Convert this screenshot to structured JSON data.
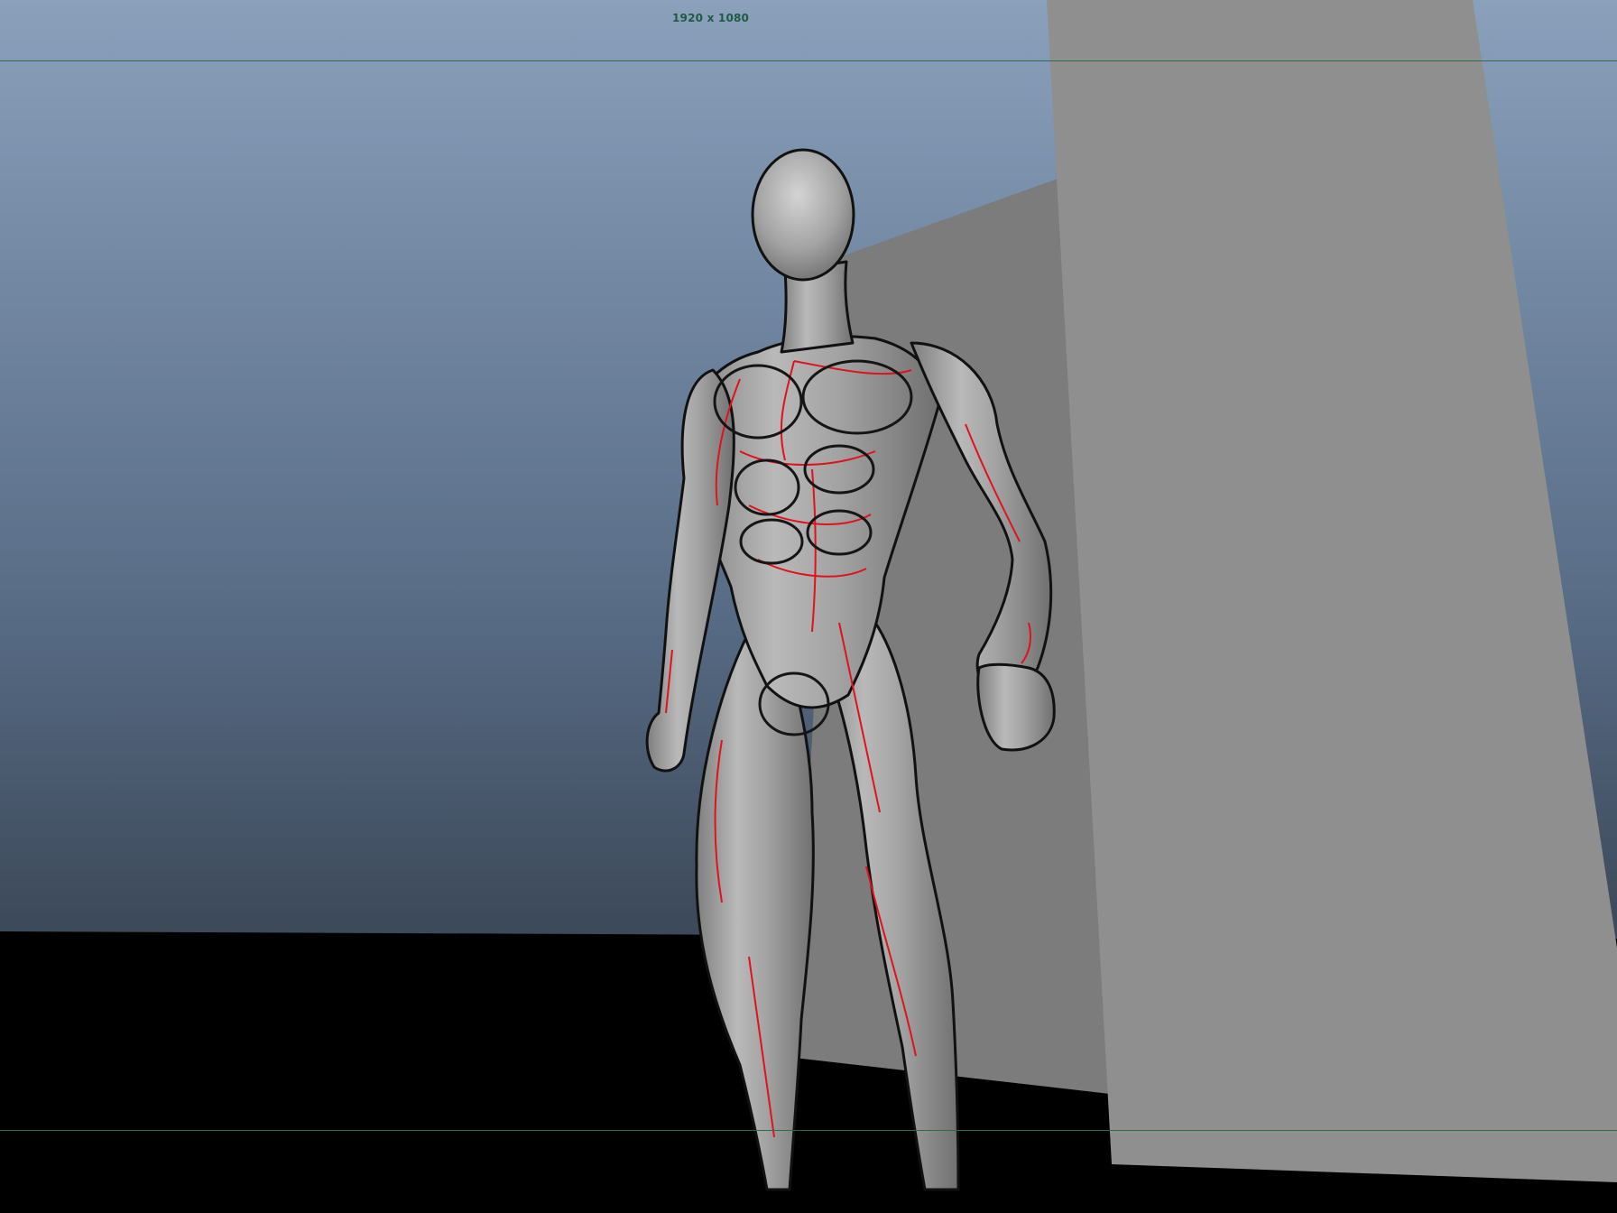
{
  "viewport": {
    "resolution_gate_label": "1920 x 1080",
    "colors": {
      "sky_top": "#8aa0bb",
      "sky_bottom": "#2a323d",
      "ground": "#000000",
      "gate_line": "#2f6b4a",
      "muscle_gap": "#e0121b",
      "character_skin": "#a6a6a6"
    },
    "objects": [
      "muscle-figure",
      "back-wall-plane",
      "side-wall-plane",
      "ground-plane"
    ]
  }
}
